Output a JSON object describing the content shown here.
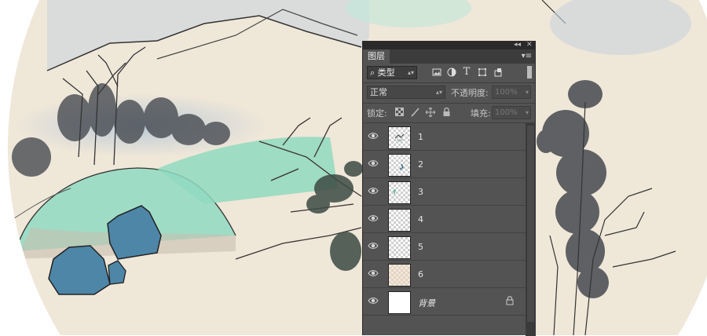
{
  "panel": {
    "title": "图层",
    "collapse_label": "◂◂",
    "close_label": "✕",
    "menu_label": "▾≡",
    "filter": {
      "kind_label": "类型",
      "kind_prefix": "⌕",
      "icons": [
        "image-filter-icon",
        "adjustment-filter-icon",
        "type-filter-icon",
        "shape-filter-icon",
        "smart-object-filter-icon"
      ]
    },
    "blend_mode": "正常",
    "opacity_label": "不透明度:",
    "opacity_value": "100%",
    "lock_label": "锁定:",
    "fill_label": "填充:",
    "fill_value": "100%"
  },
  "layers": [
    {
      "name": "1",
      "visible": true
    },
    {
      "name": "2",
      "visible": true
    },
    {
      "name": "3",
      "visible": true
    },
    {
      "name": "4",
      "visible": true
    },
    {
      "name": "5",
      "visible": true
    },
    {
      "name": "6",
      "visible": true
    },
    {
      "name": "背景",
      "visible": true,
      "locked": true
    }
  ],
  "colors": {
    "paper": "#efe7d8",
    "panel_bg": "#535353",
    "rock_blue": "#4e86a8",
    "hill_green": "#8fd9c0"
  }
}
